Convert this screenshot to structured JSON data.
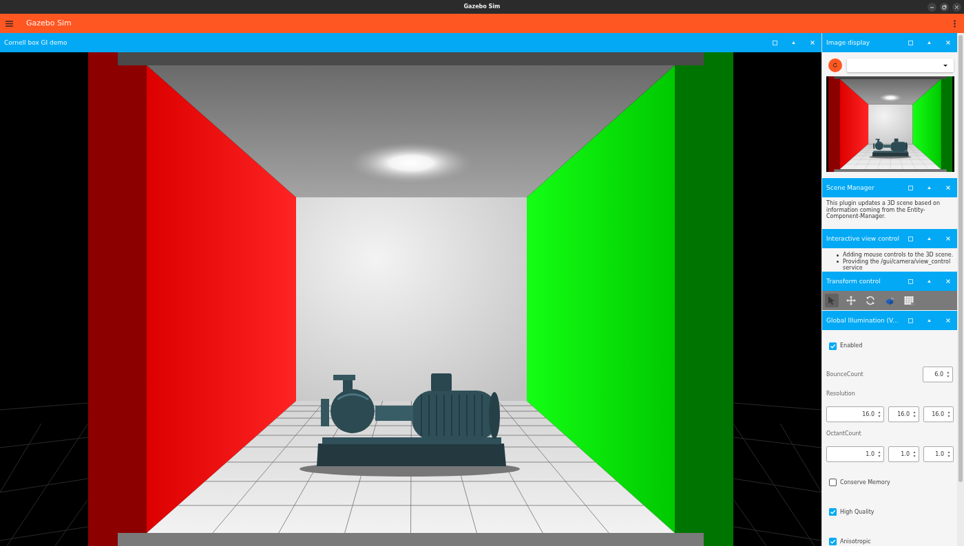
{
  "window": {
    "title": "Gazebo Sim"
  },
  "app_bar": {
    "title": "Gazebo Sim"
  },
  "viewport": {
    "title": "Cornell box GI demo"
  },
  "panels": [
    {
      "kind": "image_display",
      "title": "Image display"
    },
    {
      "kind": "text",
      "title": "Scene Manager",
      "text": "This plugin updates a 3D scene based on information coming from the Entity-Component-Manager."
    },
    {
      "kind": "bullets",
      "title": "Interactive view control",
      "items": [
        "Adding mouse controls to the 3D scene.",
        "Providing the /gui/camera/view_control service"
      ]
    },
    {
      "kind": "toolbar",
      "title": "Transform control",
      "tools": [
        {
          "kind": "select",
          "selected": true
        },
        {
          "kind": "translate",
          "selected": false
        },
        {
          "kind": "rotate",
          "selected": false
        },
        {
          "kind": "snap",
          "selected": false
        },
        {
          "kind": "grid",
          "selected": false
        }
      ]
    },
    {
      "kind": "settings",
      "title": "Global Illumination (V...",
      "fields": [
        {
          "kind": "checkbox",
          "label": "Enabled",
          "checked": true
        },
        {
          "kind": "number",
          "label": "BounceCount",
          "value": "6.0"
        },
        {
          "kind": "vector",
          "label": "Resolution",
          "values": [
            "16.0",
            "16.0",
            "16.0"
          ]
        },
        {
          "kind": "vector",
          "label": "OctantCount",
          "values": [
            "1.0",
            "1.0",
            "1.0"
          ]
        },
        {
          "kind": "checkbox",
          "label": "Conserve Memory",
          "checked": false
        },
        {
          "kind": "checkbox",
          "label": "High Quality",
          "checked": true
        },
        {
          "kind": "checkbox",
          "label": "Anisotropic",
          "checked": true
        }
      ]
    }
  ]
}
